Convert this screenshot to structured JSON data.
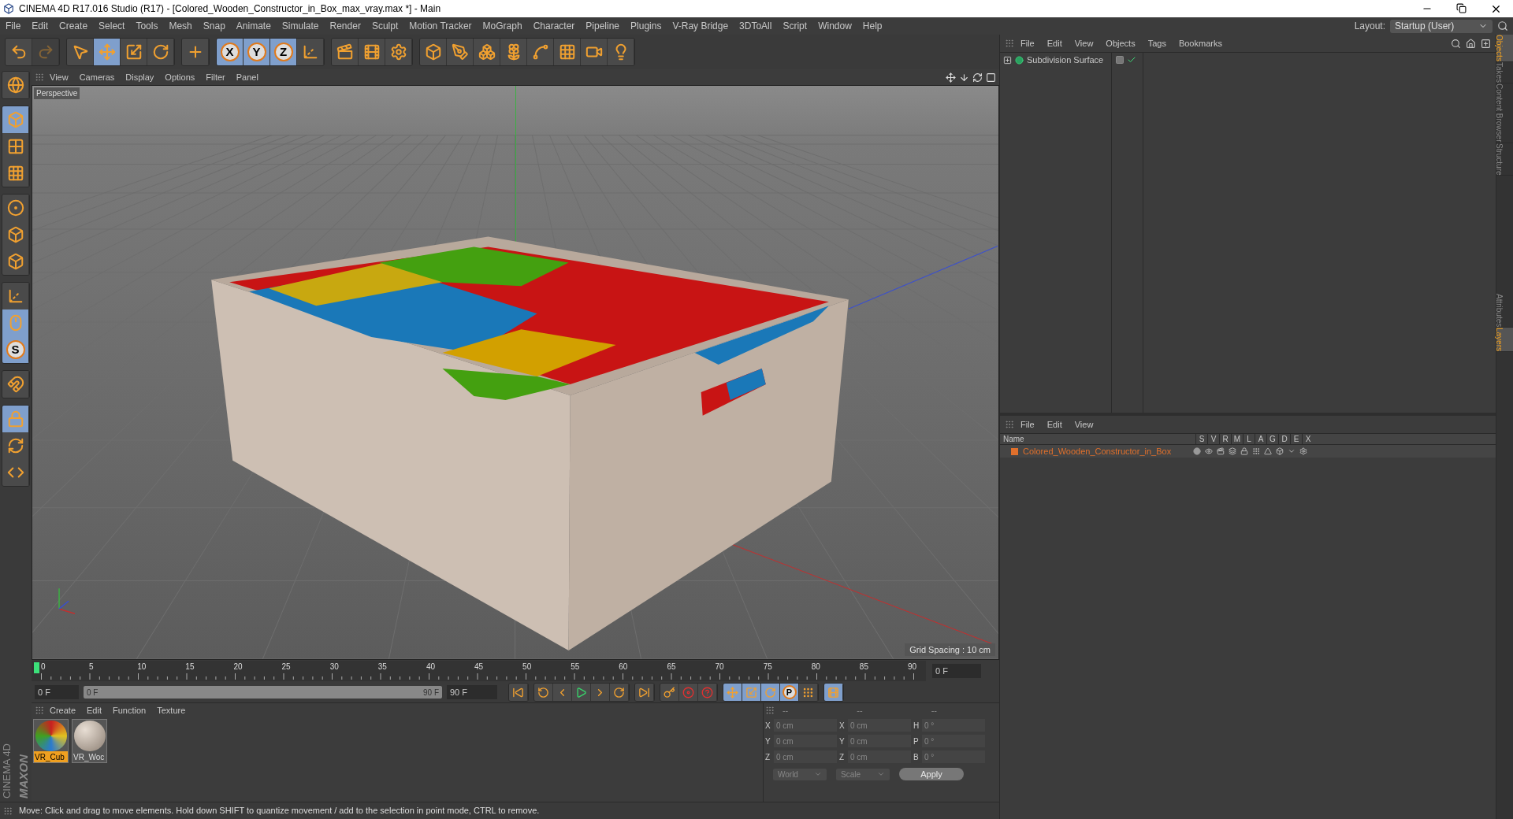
{
  "window": {
    "title": "CINEMA 4D R17.016 Studio (R17) - [Colored_Wooden_Constructor_in_Box_max_vray.max *] - Main"
  },
  "menu": [
    "File",
    "Edit",
    "Create",
    "Select",
    "Tools",
    "Mesh",
    "Snap",
    "Animate",
    "Simulate",
    "Render",
    "Sculpt",
    "Motion Tracker",
    "MoGraph",
    "Character",
    "Pipeline",
    "Plugins",
    "V-Ray Bridge",
    "3DToAll",
    "Script",
    "Window",
    "Help"
  ],
  "layout": {
    "label": "Layout:",
    "value": "Startup (User)"
  },
  "toolbar": [
    [
      {
        "selected": false,
        "disabled": false
      },
      {
        "selected": false,
        "disabled": true
      }
    ],
    [
      {
        "selected": false
      },
      {
        "selected": true
      },
      {
        "selected": false
      },
      {
        "selected": false
      }
    ],
    [
      {
        "selected": false
      }
    ],
    [
      {
        "label": "X",
        "selected": true
      },
      {
        "label": "Y",
        "selected": true
      },
      {
        "label": "Z",
        "selected": true
      },
      {
        "selected": false
      }
    ],
    [
      {
        "selected": false
      },
      {
        "selected": false
      },
      {
        "selected": false
      }
    ],
    [
      {
        "selected": false
      },
      {
        "selected": false
      },
      {
        "selected": false
      },
      {
        "selected": false
      },
      {
        "selected": false
      },
      {
        "selected": false
      },
      {
        "selected": false
      },
      {
        "selected": false
      }
    ]
  ],
  "left_tools": [
    [
      {
        "selected": false
      }
    ],
    [
      {
        "selected": true
      },
      {
        "selected": false
      },
      {
        "selected": false
      }
    ],
    [
      {
        "selected": false
      },
      {
        "selected": false
      },
      {
        "selected": false
      }
    ],
    [
      {
        "selected": false
      },
      {
        "selected": true
      },
      {
        "label": "S",
        "selected": true
      }
    ],
    [
      {
        "selected": false
      }
    ],
    [
      {
        "selected": true
      },
      {
        "selected": false
      },
      {
        "selected": false
      }
    ]
  ],
  "logo": {
    "brand": "MAXON",
    "product": "CINEMA 4D"
  },
  "viewport": {
    "menu": [
      "View",
      "Cameras",
      "Display",
      "Options",
      "Filter",
      "Panel"
    ],
    "camera": "Perspective",
    "grid_spacing": "Grid Spacing : 10 cm"
  },
  "timeline": {
    "ticks": [
      "0",
      "5",
      "10",
      "15",
      "20",
      "25",
      "30",
      "35",
      "40",
      "45",
      "50",
      "55",
      "60",
      "65",
      "70",
      "75",
      "80",
      "85",
      "90"
    ],
    "current": "0 F"
  },
  "transport": {
    "start": "0 F",
    "range": {
      "start": "0 F",
      "end": "90 F",
      "level": 1
    },
    "end": "90 F",
    "buttons": [
      [
        {
          "selected": false
        }
      ],
      [
        {
          "selected": false
        },
        {
          "selected": false
        },
        {
          "selected": false
        },
        {
          "selected": false
        },
        {
          "selected": false
        }
      ],
      [
        {
          "selected": false
        }
      ],
      [
        {
          "selected": false
        },
        {
          "selected": false
        },
        {
          "selected": false
        }
      ],
      [
        {
          "selected": true
        },
        {
          "selected": true
        },
        {
          "selected": true
        },
        {
          "label": "P",
          "selected": true
        },
        {
          "selected": false
        }
      ],
      [
        {
          "selected": true
        }
      ]
    ]
  },
  "materials": {
    "menu": [
      "Create",
      "Edit",
      "Function",
      "Texture"
    ],
    "items": [
      {
        "name": "VR_Cub",
        "kind": "multicolor",
        "selected": true
      },
      {
        "name": "VR_Woc",
        "kind": "wood",
        "selected": false
      }
    ]
  },
  "coordinates": {
    "headers": [
      "--",
      "--",
      "--"
    ],
    "rows": [
      {
        "axis": "X",
        "position": "0 cm",
        "axis_2": "X",
        "size": "0 cm",
        "rot_axis": "H",
        "rotation": "0 °"
      },
      {
        "axis": "Y",
        "position": "0 cm",
        "axis_2": "Y",
        "size": "0 cm",
        "rot_axis": "P",
        "rotation": "0 °"
      },
      {
        "axis": "Z",
        "position": "0 cm",
        "axis_2": "Z",
        "size": "0 cm",
        "rot_axis": "B",
        "rotation": "0 °"
      }
    ],
    "dropdowns": [
      "World",
      "Scale"
    ],
    "apply": "Apply"
  },
  "status_bar": "Move: Click and drag to move elements. Hold down SHIFT to quantize movement / add to the selection in point mode, CTRL to remove.",
  "objects_panel": {
    "menu": [
      "File",
      "Edit",
      "View",
      "Objects",
      "Tags",
      "Bookmarks"
    ],
    "items": [
      {
        "name": "Subdivision Surface"
      }
    ]
  },
  "layers_panel": {
    "menu": [
      "File",
      "Edit",
      "View"
    ],
    "columns": [
      "Name",
      "S",
      "V",
      "R",
      "M",
      "L",
      "A",
      "G",
      "D",
      "E",
      "X"
    ],
    "rows": [
      {
        "name": "Colored_Wooden_Constructor_in_Box",
        "color": "#e0702c"
      }
    ]
  },
  "side_tabs_top": [
    {
      "label": "Objects",
      "selected": true
    },
    {
      "label": "Takes",
      "selected": false
    },
    {
      "label": "Content Browser",
      "selected": false
    },
    {
      "label": "Structure",
      "selected": false
    }
  ],
  "side_tabs_bottom": [
    {
      "label": "Attributes",
      "selected": false
    },
    {
      "label": "Layers",
      "selected": true
    }
  ]
}
